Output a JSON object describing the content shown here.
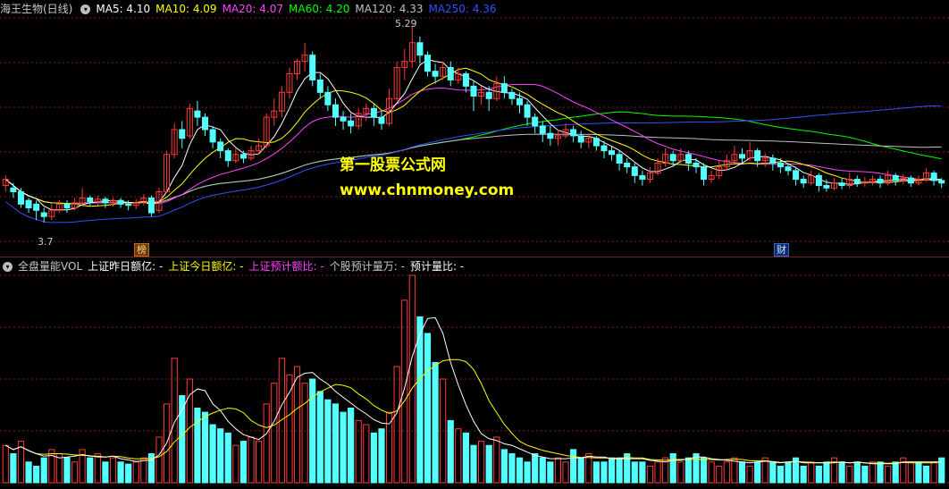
{
  "top_header": {
    "stock_name": "海王生物(日线)",
    "ma5": "MA5: 4.10",
    "ma10": "MA10: 4.09",
    "ma20": "MA20: 4.07",
    "ma60": "MA60: 4.20",
    "ma120": "MA120: 4.33",
    "ma250": "MA250: 4.36"
  },
  "bottom_header": {
    "indicator": "全盘量能VOL",
    "prev_day": "上证昨日额亿: -",
    "today": "上证今日额亿: -",
    "ratio": "上证预计额比: -",
    "stock_est": "个股预计量万: -",
    "est_ratio": "预计量比: -"
  },
  "watermark": {
    "line1": "第一股票公式网",
    "line2": "www.chnmoney.com"
  },
  "tags": {
    "bang": "榜",
    "cai": "财"
  },
  "annotations": {
    "high": "5.29",
    "low": "3.7"
  },
  "colors": {
    "up": "#ff3a3a",
    "down": "#54ffff",
    "ma5": "#ffffff",
    "ma10": "#ffff00",
    "ma20": "#ff44ff",
    "ma60": "#00ff00",
    "ma120": "#c0c0c0",
    "ma250": "#3050ff",
    "grid": "#7a1f1f"
  },
  "chart_data": [
    {
      "type": "candlestick",
      "title": "海王生物(日线)",
      "ylim": [
        3.55,
        5.35
      ],
      "high": 5.29,
      "low": 3.7,
      "moving_averages": [
        {
          "name": "MA5",
          "value": 4.1
        },
        {
          "name": "MA10",
          "value": 4.09
        },
        {
          "name": "MA20",
          "value": 4.07
        },
        {
          "name": "MA60",
          "value": 4.2
        },
        {
          "name": "MA120",
          "value": 4.33
        },
        {
          "name": "MA250",
          "value": 4.36
        }
      ],
      "candles": [
        [
          4.0,
          4.05,
          3.95,
          4.08
        ],
        [
          3.98,
          3.95,
          3.9,
          4.02
        ],
        [
          3.95,
          3.85,
          3.82,
          3.98
        ],
        [
          3.88,
          3.82,
          3.78,
          3.9
        ],
        [
          3.85,
          3.8,
          3.72,
          3.88
        ],
        [
          3.78,
          3.75,
          3.7,
          3.82
        ],
        [
          3.75,
          3.8,
          3.72,
          3.85
        ],
        [
          3.8,
          3.85,
          3.78,
          3.88
        ],
        [
          3.85,
          3.82,
          3.78,
          3.88
        ],
        [
          3.82,
          3.86,
          3.8,
          3.9
        ],
        [
          3.86,
          3.9,
          3.83,
          3.98
        ],
        [
          3.9,
          3.87,
          3.84,
          3.92
        ],
        [
          3.87,
          3.89,
          3.84,
          3.92
        ],
        [
          3.89,
          3.86,
          3.82,
          3.91
        ],
        [
          3.86,
          3.88,
          3.83,
          3.9
        ],
        [
          3.88,
          3.85,
          3.82,
          3.9
        ],
        [
          3.85,
          3.84,
          3.8,
          3.88
        ],
        [
          3.84,
          3.86,
          3.81,
          3.89
        ],
        [
          3.86,
          3.9,
          3.84,
          3.93
        ],
        [
          3.9,
          3.78,
          3.75,
          3.92
        ],
        [
          3.8,
          3.95,
          3.78,
          3.98
        ],
        [
          3.95,
          4.25,
          3.94,
          4.28
        ],
        [
          4.25,
          4.45,
          4.22,
          4.5
        ],
        [
          4.45,
          4.38,
          4.3,
          4.52
        ],
        [
          4.4,
          4.62,
          4.38,
          4.66
        ],
        [
          4.6,
          4.55,
          4.48,
          4.68
        ],
        [
          4.55,
          4.45,
          4.4,
          4.58
        ],
        [
          4.45,
          4.35,
          4.3,
          4.48
        ],
        [
          4.35,
          4.28,
          4.22,
          4.38
        ],
        [
          4.28,
          4.2,
          4.15,
          4.3
        ],
        [
          4.2,
          4.25,
          4.18,
          4.3
        ],
        [
          4.25,
          4.22,
          4.18,
          4.28
        ],
        [
          4.22,
          4.28,
          4.2,
          4.32
        ],
        [
          4.28,
          4.32,
          4.25,
          4.38
        ],
        [
          4.32,
          4.55,
          4.3,
          4.58
        ],
        [
          4.55,
          4.6,
          4.48,
          4.7
        ],
        [
          4.6,
          4.75,
          4.55,
          4.8
        ],
        [
          4.75,
          4.9,
          4.7,
          4.95
        ],
        [
          4.9,
          5.0,
          4.85,
          5.02
        ],
        [
          5.0,
          5.05,
          4.92,
          5.15
        ],
        [
          5.05,
          4.85,
          4.8,
          5.08
        ],
        [
          4.85,
          4.75,
          4.7,
          4.9
        ],
        [
          4.75,
          4.65,
          4.6,
          4.8
        ],
        [
          4.65,
          4.55,
          4.48,
          4.7
        ],
        [
          4.55,
          4.52,
          4.45,
          4.6
        ],
        [
          4.52,
          4.48,
          4.42,
          4.58
        ],
        [
          4.48,
          4.58,
          4.45,
          4.62
        ],
        [
          4.58,
          4.62,
          4.52,
          4.66
        ],
        [
          4.62,
          4.55,
          4.48,
          4.66
        ],
        [
          4.55,
          4.5,
          4.45,
          4.6
        ],
        [
          4.5,
          4.7,
          4.48,
          4.78
        ],
        [
          4.7,
          4.95,
          4.68,
          5.0
        ],
        [
          4.95,
          5.0,
          4.85,
          5.1
        ],
        [
          5.0,
          5.15,
          4.95,
          5.29
        ],
        [
          5.15,
          5.05,
          4.98,
          5.2
        ],
        [
          5.05,
          4.92,
          4.88,
          5.08
        ],
        [
          4.92,
          4.88,
          4.82,
          4.98
        ],
        [
          4.88,
          4.95,
          4.85,
          5.0
        ],
        [
          4.95,
          4.85,
          4.8,
          5.0
        ],
        [
          4.85,
          4.9,
          4.82,
          4.95
        ],
        [
          4.9,
          4.8,
          4.75,
          4.92
        ],
        [
          4.8,
          4.72,
          4.6,
          4.85
        ],
        [
          4.72,
          4.75,
          4.65,
          4.8
        ],
        [
          4.75,
          4.7,
          4.6,
          4.8
        ],
        [
          4.7,
          4.82,
          4.68,
          4.88
        ],
        [
          4.82,
          4.75,
          4.7,
          4.88
        ],
        [
          4.75,
          4.7,
          4.65,
          4.78
        ],
        [
          4.7,
          4.65,
          4.58,
          4.75
        ],
        [
          4.65,
          4.55,
          4.48,
          4.68
        ],
        [
          4.55,
          4.48,
          4.42,
          4.58
        ],
        [
          4.48,
          4.42,
          4.35,
          4.52
        ],
        [
          4.42,
          4.38,
          4.32,
          4.48
        ],
        [
          4.38,
          4.4,
          4.32,
          4.45
        ],
        [
          4.4,
          4.45,
          4.38,
          4.5
        ],
        [
          4.45,
          4.4,
          4.35,
          4.48
        ],
        [
          4.4,
          4.35,
          4.3,
          4.44
        ],
        [
          4.35,
          4.38,
          4.3,
          4.42
        ],
        [
          4.38,
          4.32,
          4.28,
          4.4
        ],
        [
          4.32,
          4.28,
          4.22,
          4.36
        ],
        [
          4.28,
          4.25,
          4.2,
          4.32
        ],
        [
          4.25,
          4.18,
          4.12,
          4.28
        ],
        [
          4.18,
          4.15,
          4.1,
          4.22
        ],
        [
          4.15,
          4.08,
          4.02,
          4.18
        ],
        [
          4.08,
          4.05,
          4.0,
          4.12
        ],
        [
          4.05,
          4.1,
          4.02,
          4.15
        ],
        [
          4.1,
          4.18,
          4.08,
          4.22
        ],
        [
          4.18,
          4.25,
          4.15,
          4.3
        ],
        [
          4.25,
          4.2,
          4.15,
          4.28
        ],
        [
          4.2,
          4.25,
          4.18,
          4.3
        ],
        [
          4.25,
          4.18,
          4.12,
          4.28
        ],
        [
          4.18,
          4.15,
          4.1,
          4.22
        ],
        [
          4.15,
          4.05,
          4.0,
          4.18
        ],
        [
          4.05,
          4.08,
          4.02,
          4.12
        ],
        [
          4.08,
          4.15,
          4.05,
          4.2
        ],
        [
          4.15,
          4.2,
          4.12,
          4.25
        ],
        [
          4.2,
          4.25,
          4.18,
          4.32
        ],
        [
          4.25,
          4.22,
          4.18,
          4.3
        ],
        [
          4.22,
          4.28,
          4.2,
          4.35
        ],
        [
          4.28,
          4.2,
          4.15,
          4.3
        ],
        [
          4.2,
          4.22,
          4.15,
          4.26
        ],
        [
          4.22,
          4.18,
          4.12,
          4.25
        ],
        [
          4.18,
          4.15,
          4.1,
          4.22
        ],
        [
          4.15,
          4.12,
          4.08,
          4.18
        ],
        [
          4.12,
          4.05,
          4.0,
          4.15
        ],
        [
          4.05,
          4.02,
          3.98,
          4.08
        ],
        [
          4.02,
          4.08,
          4.0,
          4.12
        ],
        [
          4.08,
          4.0,
          3.95,
          4.1
        ],
        [
          4.0,
          3.98,
          3.95,
          4.05
        ],
        [
          3.98,
          4.02,
          3.96,
          4.06
        ],
        [
          4.02,
          4.0,
          3.97,
          4.06
        ],
        [
          4.0,
          4.05,
          3.98,
          4.1
        ],
        [
          4.05,
          4.02,
          3.99,
          4.08
        ],
        [
          4.02,
          4.03,
          3.99,
          4.07
        ],
        [
          4.03,
          4.05,
          4.0,
          4.08
        ],
        [
          4.05,
          4.02,
          3.98,
          4.08
        ],
        [
          4.02,
          4.08,
          4.0,
          4.12
        ],
        [
          4.08,
          4.04,
          4.0,
          4.1
        ],
        [
          4.04,
          4.06,
          4.01,
          4.09
        ],
        [
          4.06,
          4.02,
          3.99,
          4.08
        ],
        [
          4.02,
          4.05,
          4.0,
          4.08
        ],
        [
          4.05,
          4.1,
          4.03,
          4.14
        ],
        [
          4.1,
          4.04,
          4.0,
          4.12
        ],
        [
          4.04,
          4.02,
          3.98,
          4.06
        ]
      ]
    },
    {
      "type": "bar",
      "title": "全盘量能VOL",
      "ylim": [
        0,
        100
      ],
      "values": [
        18,
        14,
        20,
        10,
        8,
        12,
        16,
        14,
        12,
        10,
        16,
        12,
        14,
        10,
        12,
        10,
        9,
        10,
        12,
        14,
        22,
        38,
        60,
        42,
        50,
        36,
        34,
        28,
        26,
        24,
        18,
        20,
        22,
        20,
        38,
        48,
        60,
        52,
        56,
        48,
        50,
        44,
        40,
        38,
        34,
        36,
        30,
        28,
        24,
        26,
        34,
        56,
        88,
        100,
        80,
        72,
        58,
        50,
        30,
        26,
        24,
        18,
        20,
        18,
        22,
        16,
        14,
        12,
        10,
        14,
        12,
        10,
        12,
        10,
        16,
        12,
        14,
        10,
        10,
        12,
        12,
        14,
        10,
        10,
        8,
        10,
        12,
        14,
        10,
        12,
        14,
        12,
        10,
        8,
        10,
        12,
        10,
        8,
        10,
        12,
        10,
        8,
        10,
        12,
        8,
        10,
        8,
        10,
        12,
        10,
        8,
        10,
        8,
        10,
        10,
        8,
        10,
        12,
        10,
        10,
        8,
        10,
        12
      ],
      "up_flags": [
        1,
        0,
        1,
        0,
        0,
        0,
        1,
        1,
        0,
        1,
        1,
        0,
        1,
        0,
        1,
        0,
        0,
        1,
        1,
        0,
        1,
        1,
        1,
        0,
        1,
        0,
        0,
        0,
        0,
        0,
        1,
        0,
        1,
        1,
        1,
        1,
        1,
        1,
        1,
        1,
        0,
        0,
        0,
        0,
        0,
        0,
        1,
        1,
        0,
        0,
        1,
        1,
        1,
        1,
        0,
        0,
        0,
        1,
        0,
        1,
        0,
        0,
        1,
        0,
        1,
        0,
        0,
        0,
        0,
        0,
        0,
        0,
        1,
        1,
        0,
        0,
        1,
        0,
        0,
        0,
        0,
        0,
        0,
        0,
        1,
        1,
        1,
        0,
        1,
        0,
        0,
        0,
        1,
        1,
        1,
        1,
        0,
        1,
        0,
        1,
        0,
        0,
        0,
        0,
        0,
        1,
        0,
        0,
        1,
        0,
        1,
        0,
        0,
        1,
        0,
        1,
        0,
        1,
        1,
        0,
        0,
        1,
        0
      ]
    }
  ]
}
